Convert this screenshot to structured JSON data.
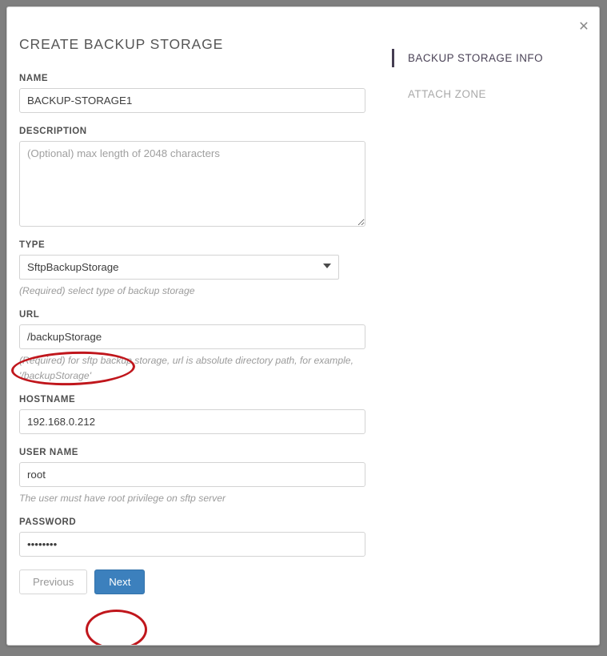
{
  "window": {
    "close_icon": "close-icon",
    "backdrop_color": "#7f7f7f",
    "panel_color": "#ffffff"
  },
  "dialog": {
    "title": "CREATE BACKUP STORAGE"
  },
  "form": {
    "name": {
      "label": "NAME",
      "value": "BACKUP-STORAGE1",
      "placeholder": ""
    },
    "description": {
      "label": "DESCRIPTION",
      "value": "",
      "placeholder": "(Optional) max length of 2048 characters"
    },
    "type": {
      "label": "TYPE",
      "value": "SftpBackupStorage",
      "help": "(Required) select type of backup storage",
      "options": [
        "SftpBackupStorage"
      ],
      "arrow_icon": "chevron-down-icon"
    },
    "url": {
      "label": "URL",
      "value": "/backupStorage",
      "placeholder": "",
      "help": "(Required) for sftp backup storage, url is absolute directory path, for example, '/backupStorage'"
    },
    "hostname": {
      "label": "HOSTNAME",
      "value": "192.168.0.212",
      "placeholder": ""
    },
    "username": {
      "label": "USER NAME",
      "value": "root",
      "placeholder": "",
      "help": "The user must have root privilege on sftp server"
    },
    "password": {
      "label": "PASSWORD",
      "value": "••••••••",
      "placeholder": ""
    }
  },
  "buttons": {
    "previous": "Previous",
    "next": "Next",
    "next_color": "#3c80bd"
  },
  "steps": [
    {
      "label": "BACKUP STORAGE INFO",
      "state": "active"
    },
    {
      "label": "ATTACH ZONE",
      "state": "inactive"
    }
  ],
  "annotations": {
    "color": "#c0161c",
    "shapes": [
      {
        "name": "url-field-highlight",
        "target": "url-input"
      },
      {
        "name": "next-button-highlight",
        "target": "next-button"
      }
    ]
  }
}
